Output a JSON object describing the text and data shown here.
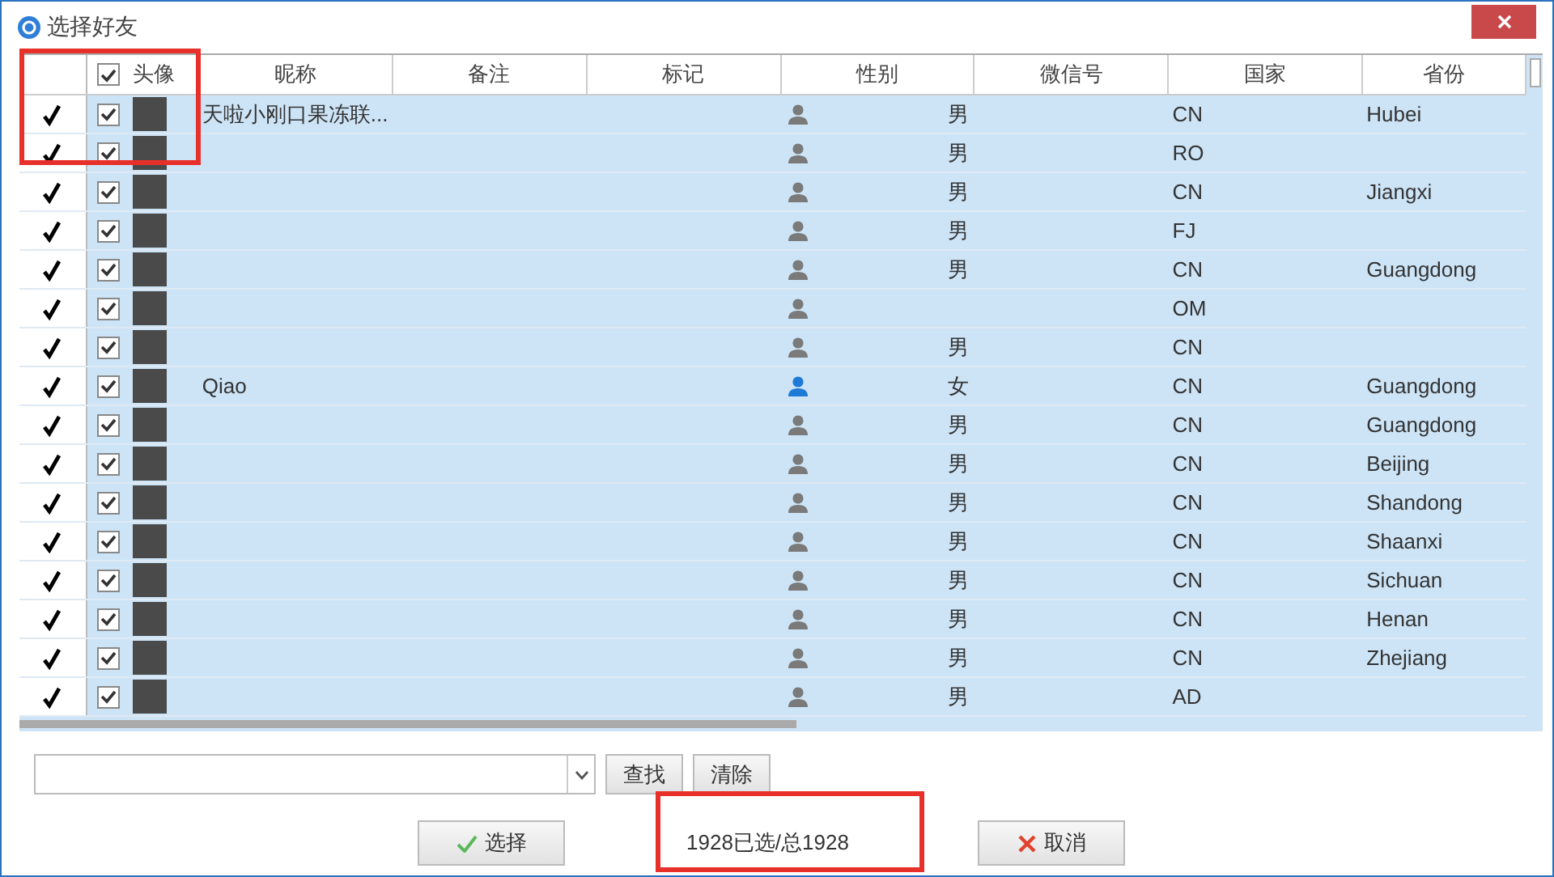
{
  "window": {
    "title": "选择好友"
  },
  "table": {
    "header_checked": true,
    "columns": [
      "头像",
      "昵称",
      "备注",
      "标记",
      "性别",
      "微信号",
      "国家",
      "省份"
    ],
    "rows": [
      {
        "marked": true,
        "checked": true,
        "selected": true,
        "nickname": "天啦小刚口果冻联...",
        "kind": "male",
        "gender": "男",
        "country": "CN",
        "province": "Hubei"
      },
      {
        "marked": true,
        "checked": true,
        "selected": true,
        "kind": "male",
        "gender": "男",
        "country": "RO"
      },
      {
        "marked": true,
        "checked": true,
        "selected": true,
        "kind": "male",
        "gender": "男",
        "country": "CN",
        "province": "Jiangxi"
      },
      {
        "marked": true,
        "checked": true,
        "selected": true,
        "kind": "male",
        "gender": "男",
        "country": "FJ"
      },
      {
        "marked": true,
        "checked": true,
        "selected": true,
        "kind": "male",
        "gender": "男",
        "country": "CN",
        "province": "Guangdong"
      },
      {
        "marked": true,
        "checked": true,
        "selected": true,
        "kind": "male",
        "country": "OM"
      },
      {
        "marked": true,
        "checked": true,
        "selected": true,
        "kind": "male",
        "gender": "男",
        "country": "CN"
      },
      {
        "marked": true,
        "checked": true,
        "selected": true,
        "nickname": "Qiao",
        "kind": "female",
        "gender": "女",
        "country": "CN",
        "province": "Guangdong"
      },
      {
        "marked": true,
        "checked": true,
        "selected": true,
        "kind": "male",
        "gender": "男",
        "country": "CN",
        "province": "Guangdong"
      },
      {
        "marked": true,
        "checked": true,
        "selected": true,
        "kind": "male",
        "gender": "男",
        "country": "CN",
        "province": "Beijing"
      },
      {
        "marked": true,
        "checked": true,
        "selected": true,
        "kind": "male",
        "gender": "男",
        "country": "CN",
        "province": "Shandong"
      },
      {
        "marked": true,
        "checked": true,
        "selected": true,
        "kind": "male",
        "gender": "男",
        "country": "CN",
        "province": "Shaanxi"
      },
      {
        "marked": true,
        "checked": true,
        "selected": true,
        "kind": "male",
        "gender": "男",
        "country": "CN",
        "province": "Sichuan"
      },
      {
        "marked": true,
        "checked": true,
        "selected": true,
        "kind": "male",
        "gender": "男",
        "country": "CN",
        "province": "Henan"
      },
      {
        "marked": true,
        "checked": true,
        "selected": true,
        "kind": "male",
        "gender": "男",
        "country": "CN",
        "province": "Zhejiang"
      },
      {
        "marked": true,
        "checked": true,
        "selected": true,
        "kind": "male",
        "gender": "男",
        "country": "AD"
      }
    ]
  },
  "search": {
    "find_button": "查找",
    "clear_button": "清除"
  },
  "footer": {
    "select_button": "选择",
    "status": "1928已选/总1928",
    "cancel_button": "取消"
  }
}
